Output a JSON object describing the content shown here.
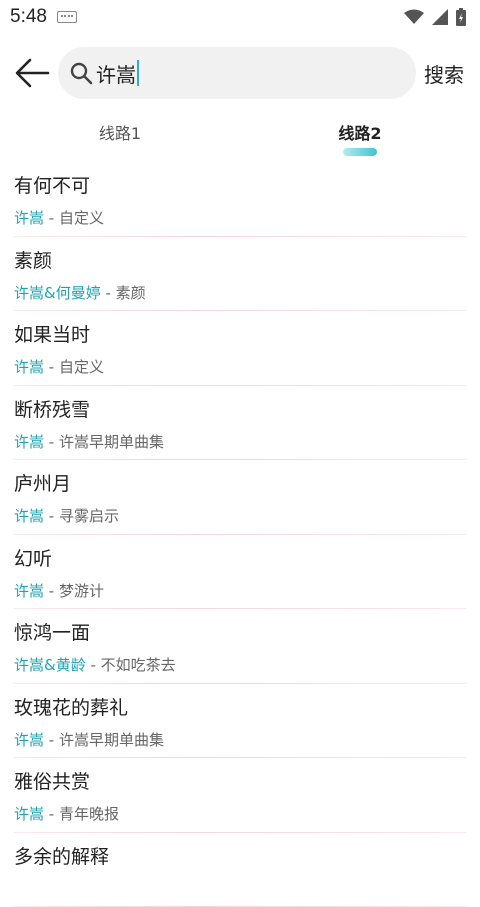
{
  "status_bar": {
    "time": "5:48"
  },
  "header": {
    "search_value": "许嵩",
    "search_button": "搜索"
  },
  "tabs": [
    {
      "label": "线路1",
      "active": false
    },
    {
      "label": "线路2",
      "active": true
    }
  ],
  "songs": [
    {
      "title": "有何不可",
      "artist": "许嵩",
      "album": " - 自定义"
    },
    {
      "title": "素颜",
      "artist": "许嵩&何曼婷",
      "album": " - 素颜"
    },
    {
      "title": "如果当时",
      "artist": "许嵩",
      "album": " - 自定义"
    },
    {
      "title": "断桥残雪",
      "artist": "许嵩",
      "album": " - 许嵩早期单曲集"
    },
    {
      "title": "庐州月",
      "artist": "许嵩",
      "album": " - 寻雾启示"
    },
    {
      "title": "幻听",
      "artist": "许嵩",
      "album": " - 梦游计"
    },
    {
      "title": "惊鸿一面",
      "artist": "许嵩&黄龄",
      "album": " - 不如吃茶去"
    },
    {
      "title": "玫瑰花的葬礼",
      "artist": "许嵩",
      "album": " - 许嵩早期单曲集"
    },
    {
      "title": "雅俗共赏",
      "artist": "许嵩",
      "album": " - 青年晚报"
    },
    {
      "title": "多余的解释",
      "artist": "",
      "album": ""
    }
  ],
  "colors": {
    "accent": "#1fa3b2",
    "indicator": "#3fc5cf"
  },
  "icons": [
    "keyboard-icon",
    "wifi-icon",
    "signal-icon",
    "battery-icon",
    "back-arrow-icon",
    "search-icon"
  ]
}
